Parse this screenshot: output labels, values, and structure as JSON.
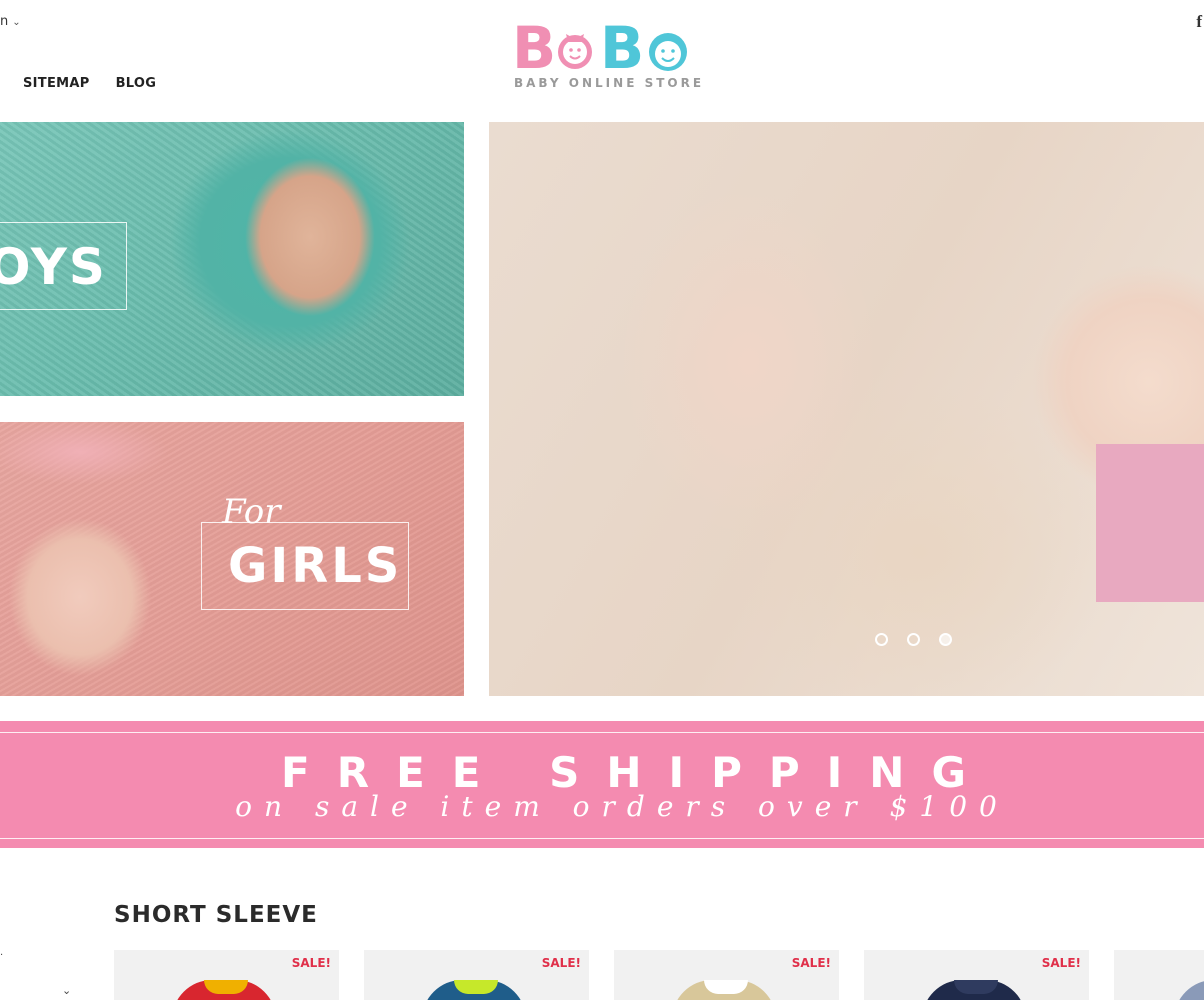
{
  "header": {
    "language": "n",
    "language_chevron": "⌄",
    "social_icon": "f",
    "nav": [
      "SITEMAP",
      "BLOG"
    ]
  },
  "logo": {
    "letters": [
      "B",
      "B"
    ],
    "subtitle": "BABY ONLINE STORE",
    "colors": {
      "pink": "#f08fb3",
      "blue": "#4fc6d8"
    }
  },
  "banners": {
    "boys": {
      "label": "OYS"
    },
    "girls": {
      "script": "For",
      "label": "GIRLS"
    },
    "hero": {
      "slides": 3,
      "active_slide": 3
    }
  },
  "promo": {
    "title": "FREE SHIPPING",
    "subtitle": "on sale item orders over $100",
    "color": "#f48bb0"
  },
  "section": {
    "title": "SHORT SLEEVE",
    "products": [
      {
        "badge": "SALE!",
        "garment_color": "#d8262f",
        "collar_color": "#f0b000"
      },
      {
        "badge": "SALE!",
        "garment_color": "#1f5d8a",
        "collar_color": "#c6e82a"
      },
      {
        "badge": "SALE!",
        "garment_color": "#d8c79a",
        "collar_color": "#ffffff"
      },
      {
        "badge": "SALE!",
        "garment_color": "#1f2a4a",
        "collar_color": "#2f3b5f"
      },
      {
        "badge": "",
        "garment_color": "#8a9ab8",
        "collar_color": "#8a9ab8"
      }
    ]
  },
  "left_fragments": {
    "chevron": "⌄"
  }
}
